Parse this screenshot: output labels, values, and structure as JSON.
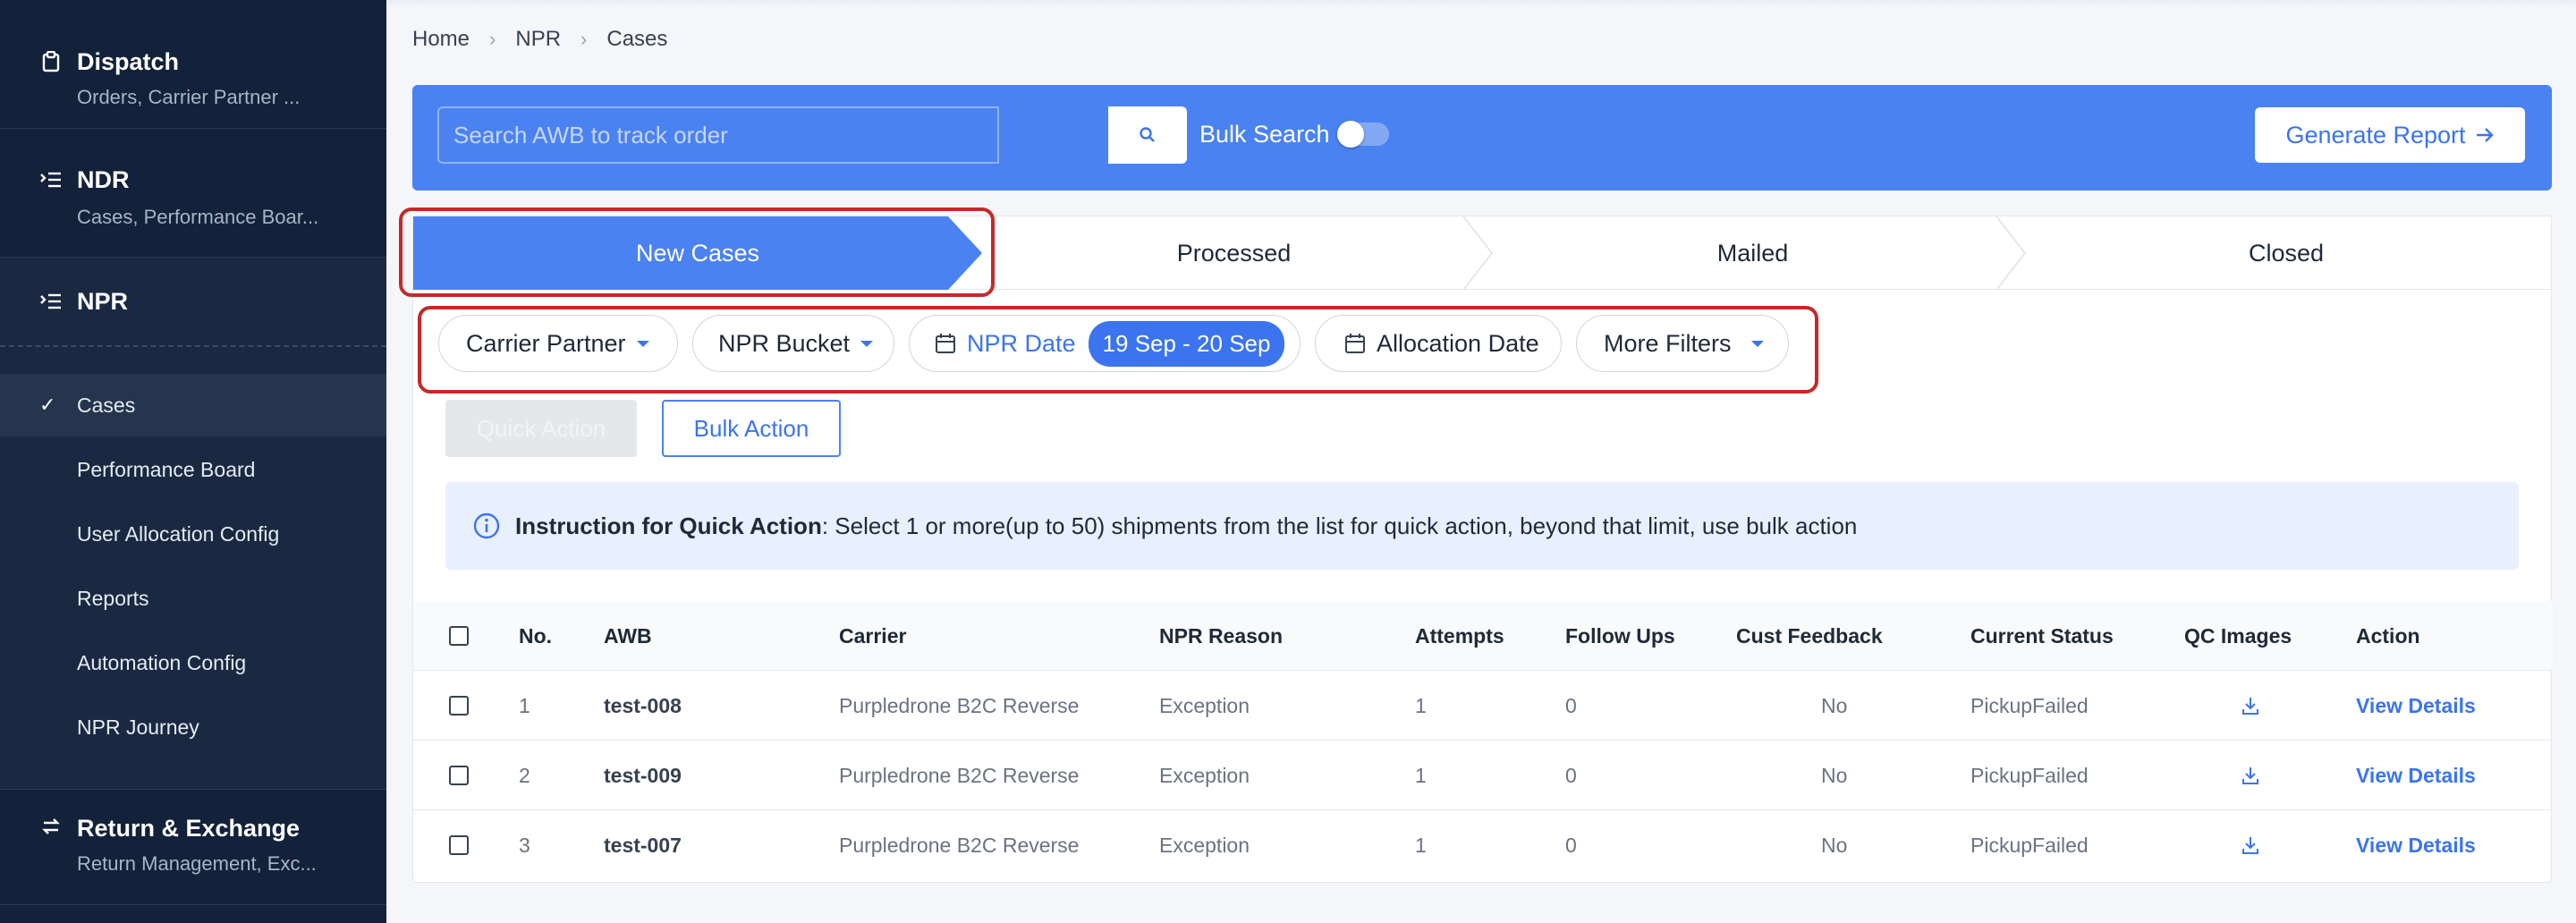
{
  "sidebar": {
    "dispatch": {
      "title": "Dispatch",
      "subtitle": "Orders, Carrier Partner ..."
    },
    "ndr": {
      "title": "NDR",
      "subtitle": "Cases, Performance Boar..."
    },
    "npr": {
      "title": "NPR"
    },
    "npr_items": [
      {
        "label": "Cases",
        "active": true
      },
      {
        "label": "Performance Board"
      },
      {
        "label": "User Allocation Config"
      },
      {
        "label": "Reports"
      },
      {
        "label": "Automation Config"
      },
      {
        "label": "NPR Journey"
      }
    ],
    "returns": {
      "title": "Return & Exchange",
      "subtitle": "Return Management, Exc..."
    }
  },
  "breadcrumb": [
    "Home",
    "NPR",
    "Cases"
  ],
  "search": {
    "placeholder": "Search AWB to track order",
    "bulk_label": "Bulk Search",
    "bulk_enabled": false
  },
  "generate_report": "Generate Report",
  "tabs": [
    {
      "label": "New Cases",
      "active": true
    },
    {
      "label": "Processed"
    },
    {
      "label": "Mailed"
    },
    {
      "label": "Closed"
    }
  ],
  "filters": {
    "carrier_partner": "Carrier Partner",
    "npr_bucket": "NPR Bucket",
    "npr_date": "NPR Date",
    "npr_date_range": "19 Sep - 20 Sep",
    "allocation_date": "Allocation Date",
    "more_filters": "More Filters"
  },
  "actions": {
    "quick": "Quick Action",
    "bulk": "Bulk Action"
  },
  "instruction": {
    "title": "Instruction for Quick Action",
    "text": ": Select 1 or more(up to 50) shipments from the list for quick action, beyond that limit, use bulk action"
  },
  "table": {
    "headers": [
      "No.",
      "AWB",
      "Carrier",
      "NPR Reason",
      "Attempts",
      "Follow Ups",
      "Cust Feedback",
      "Current Status",
      "QC Images",
      "Action"
    ],
    "rows": [
      {
        "no": "1",
        "awb": "test-008",
        "carrier": "Purpledrone B2C Reverse",
        "reason": "Exception",
        "attempts": "1",
        "followups": "0",
        "feedback": "No",
        "status": "PickupFailed",
        "action": "View Details"
      },
      {
        "no": "2",
        "awb": "test-009",
        "carrier": "Purpledrone B2C Reverse",
        "reason": "Exception",
        "attempts": "1",
        "followups": "0",
        "feedback": "No",
        "status": "PickupFailed",
        "action": "View Details"
      },
      {
        "no": "3",
        "awb": "test-007",
        "carrier": "Purpledrone B2C Reverse",
        "reason": "Exception",
        "attempts": "1",
        "followups": "0",
        "feedback": "No",
        "status": "PickupFailed",
        "action": "View Details"
      }
    ]
  },
  "colors": {
    "primary": "#4b82f1",
    "sidebar": "#13213a",
    "highlight": "#c62828"
  },
  "icons": [
    "clipboard-icon",
    "list-icon",
    "check-icon",
    "swap-icon",
    "search-icon",
    "arrow-right-icon",
    "calendar-icon",
    "info-icon",
    "download-icon"
  ]
}
